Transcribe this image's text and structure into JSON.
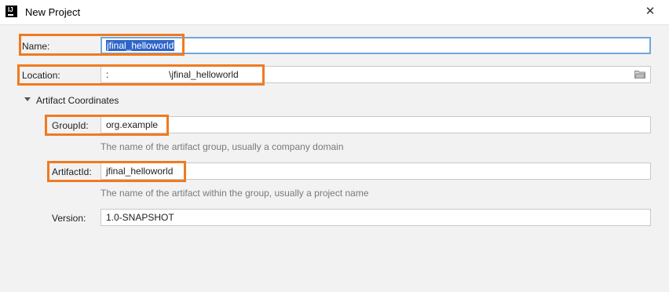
{
  "window": {
    "title": "New Project",
    "close_glyph": "✕",
    "app_icon_text": "IJ"
  },
  "form": {
    "name_label": "Name:",
    "name_value": "jfinal_helloworld",
    "location_label": "Location:",
    "location_value": ":                       \\jfinal_helloworld",
    "section_title": "Artifact Coordinates",
    "groupid_label": "GroupId:",
    "groupid_value": "org.example",
    "groupid_hint": "The name of the artifact group, usually a company domain",
    "artifactid_label": "ArtifactId:",
    "artifactid_value": "jfinal_helloworld",
    "artifactid_hint": "The name of the artifact within the group, usually a project name",
    "version_label": "Version:",
    "version_value": "1.0-SNAPSHOT"
  },
  "colors": {
    "highlight": "#ee7b22",
    "selection": "#2f65ca",
    "focus": "#6fa8dc"
  },
  "icons": {
    "app": "intellij-icon",
    "close": "close-icon",
    "browse": "folder-icon",
    "expand": "triangle-down-icon"
  }
}
